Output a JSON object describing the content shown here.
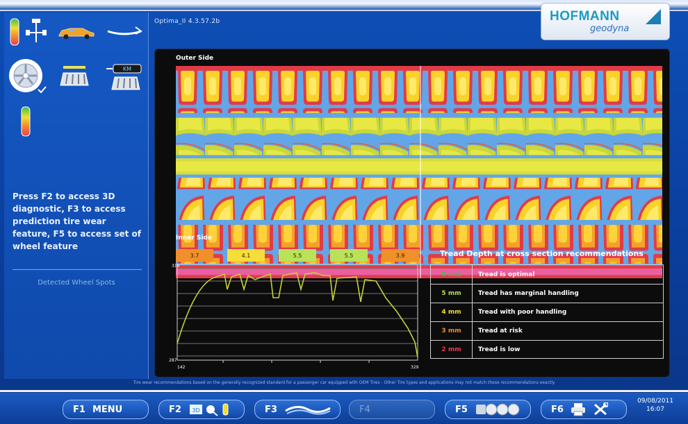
{
  "header": {
    "version": "Optima_II    4.3.57.2b",
    "logo_main": "HOFMANN",
    "logo_sub": "geodyna"
  },
  "sidebar": {
    "description": "Press F2 to access 3D diagnostic, F3 to access prediction tire wear feature, F5 to access set of wheel feature",
    "detected_label": "Detected Wheel Spots",
    "icons": [
      "tread-color-scale-icon",
      "axle-sensor-icon",
      "car-icon",
      "runout-icon",
      "wheel-rim-icon",
      "tread-scan-icon",
      "tire-speed-icon",
      "color-scale-icon"
    ]
  },
  "main": {
    "outer_label": "Outer Side",
    "inner_label": "Inner Side",
    "badges": [
      {
        "value": "3.7",
        "color": "#f0902a"
      },
      {
        "value": "4.1",
        "color": "#f6dd3a"
      },
      {
        "value": "5.5",
        "color": "#b9e25a"
      },
      {
        "value": "5.5",
        "color": "#b9e25a"
      },
      {
        "value": "3.9",
        "color": "#f0902a"
      }
    ],
    "graph": {
      "y_top": "316",
      "y_bottom": "287",
      "x_left": "142",
      "x_right": "329"
    }
  },
  "recommendations": {
    "title": "Tread Depth at cross section recommendations",
    "rows": [
      {
        "mm": "6 mm",
        "text": "Tread is optimal",
        "color": "#39c24a"
      },
      {
        "mm": "5 mm",
        "text": "Tread has marginal handling",
        "color": "#b6e04e"
      },
      {
        "mm": "4 mm",
        "text": "Tread with poor handling",
        "color": "#f2de2e"
      },
      {
        "mm": "3 mm",
        "text": "Tread at risk",
        "color": "#f18f2b"
      },
      {
        "mm": "2 mm",
        "text": "Tread is low",
        "color": "#ee3a55"
      }
    ]
  },
  "footnote": "Tire wear recommendations based on the generally recognized standard for a passenger car equipped with OEM Tires  -  Other Tire types and applications may not match these recommendations exactly",
  "function_bar": {
    "f1": {
      "key": "F1",
      "label": "MENU"
    },
    "f2": {
      "key": "F2"
    },
    "f3": {
      "key": "F3"
    },
    "f4": {
      "key": "F4"
    },
    "f5": {
      "key": "F5"
    },
    "f6": {
      "key": "F6"
    },
    "date": "09/08/2011",
    "time": "16:07"
  }
}
